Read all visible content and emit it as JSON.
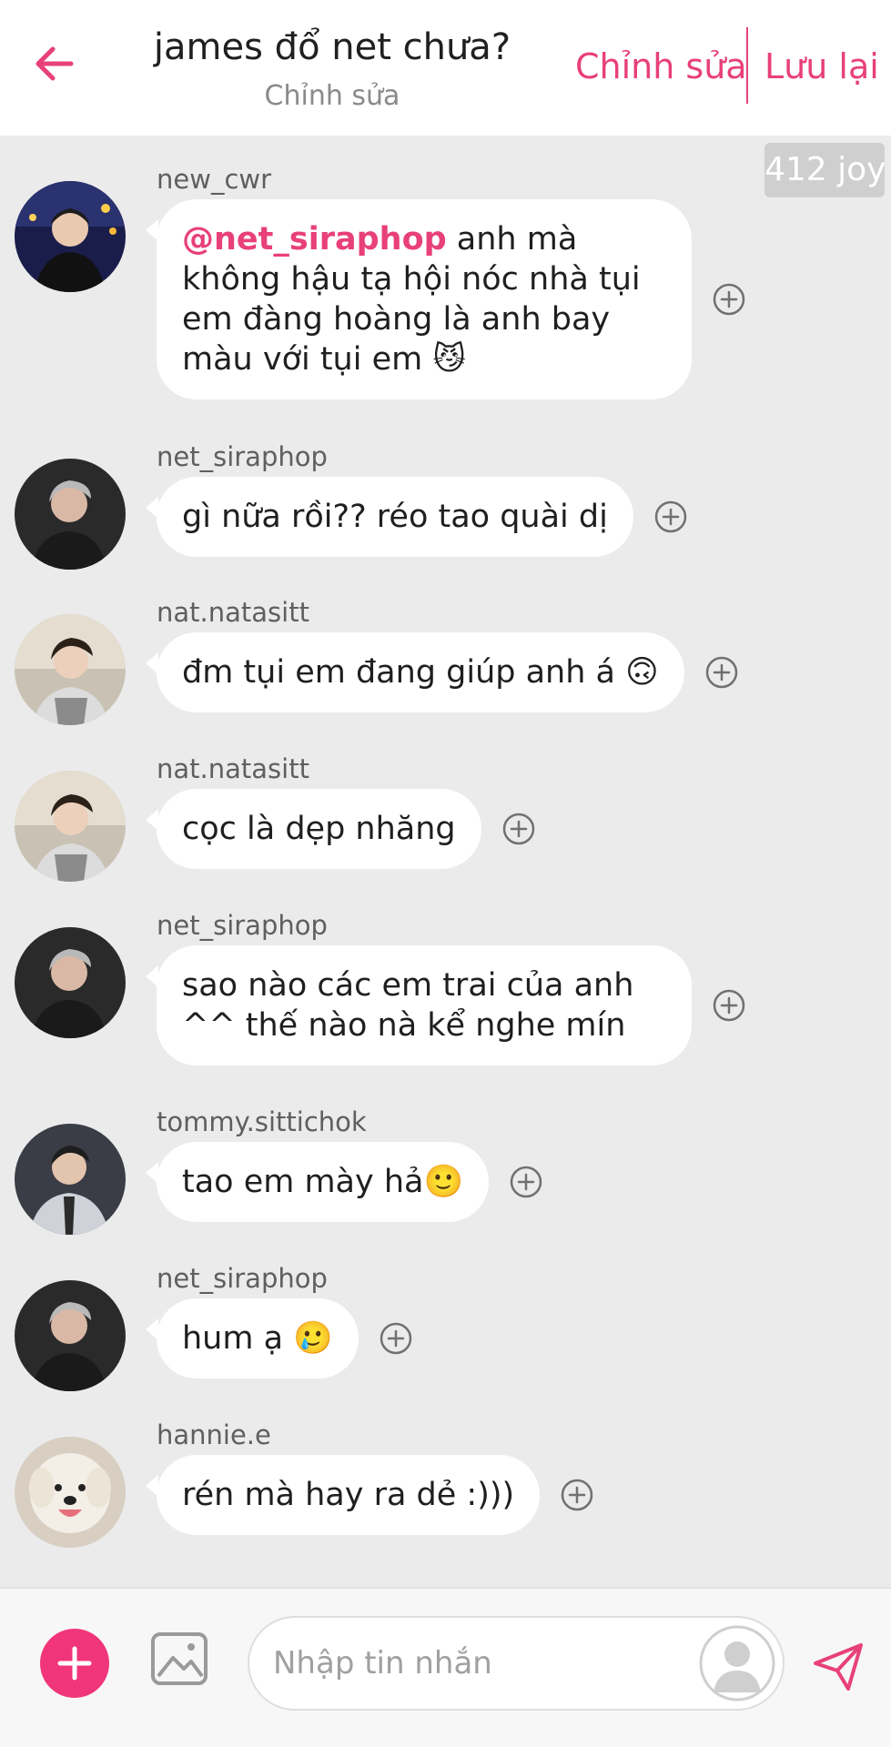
{
  "header": {
    "title": "james đổ net chưa?",
    "subtitle": "Chỉnh sửa",
    "edit_label": "Chỉnh sửa",
    "save_label": "Lưu lại"
  },
  "joy_badge": "412 joy",
  "messages": [
    {
      "username": "new_cwr",
      "mention": "@net_siraphop",
      "text": " anh mà không hậu tạ hội nóc nhà tụi em đàng hoàng là anh bay màu với tụi em 😼"
    },
    {
      "username": "net_siraphop",
      "text": "gì nữa rồi?? réo tao quài dị"
    },
    {
      "username": "nat.natasitt",
      "text": "đm tụi em đang giúp anh á 🙃"
    },
    {
      "username": "nat.natasitt",
      "text": "cọc là dẹp nhăng"
    },
    {
      "username": "net_siraphop",
      "text": "sao nào các em trai của anh ^^ thế nào nà kể nghe mín"
    },
    {
      "username": "tommy.sittichok",
      "text": "tao em mày hả🙂"
    },
    {
      "username": "net_siraphop",
      "text": "hum ạ 🥲"
    },
    {
      "username": "hannie.e",
      "text": "rén mà hay ra dẻ :)))"
    }
  ],
  "input": {
    "placeholder": "Nhập tin nhắn"
  },
  "colors": {
    "accent": "#e8407a",
    "background": "#ebebeb",
    "bubble": "#ffffff"
  },
  "icons": {
    "back": "arrow-left-icon",
    "add_reaction": "plus-circle-icon",
    "add": "plus-icon",
    "image": "image-icon",
    "send": "send-icon"
  }
}
